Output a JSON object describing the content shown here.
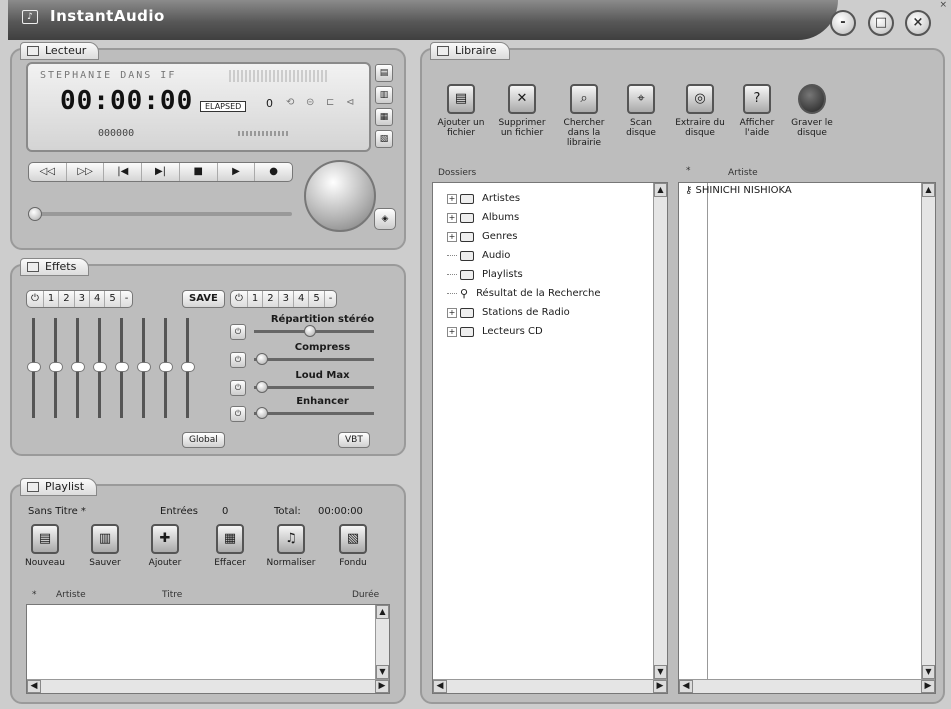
{
  "titlebar": {
    "title": "InstantAudio",
    "icon": "app-icon",
    "minimize": "-",
    "maximize": "□",
    "close": "×",
    "tiny_close": "×"
  },
  "player": {
    "tab": "Lecteur",
    "song_text": "STEPHANIE DANS IF",
    "time": "00:00:00",
    "elapsed_label": "ELAPSED",
    "track_number": "0",
    "sub_counter": "000000",
    "transport": [
      "◁◁",
      "▷▷",
      "|◀",
      "▶|",
      "■",
      "▶",
      "●"
    ]
  },
  "effects": {
    "tab": "Effets",
    "preset_left": [
      "1",
      "2",
      "3",
      "4",
      "5",
      "-"
    ],
    "save_label": "SAVE",
    "preset_right": [
      "1",
      "2",
      "3",
      "4",
      "5",
      "-"
    ],
    "sliders": [
      "Répartition stéréo",
      "Compress",
      "Loud Max",
      "Enhancer"
    ],
    "global_label": "Global",
    "vbt_label": "VBT"
  },
  "playlist": {
    "tab": "Playlist",
    "name": "Sans Titre *",
    "entries_label": "Entrées",
    "entries_value": "0",
    "total_label": "Total:",
    "total_value": "00:00:00",
    "tools": [
      "Nouveau",
      "Sauver",
      "Ajouter",
      "Effacer",
      "Normaliser",
      "Fondu"
    ],
    "columns": {
      "star": "*",
      "artist": "Artiste",
      "title": "Titre",
      "duration": "Durée"
    }
  },
  "library": {
    "tab": "Libraire",
    "tools": [
      {
        "label": "Ajouter un fichier",
        "icon": "add-file-icon"
      },
      {
        "label": "Supprimer un fichier",
        "icon": "delete-icon"
      },
      {
        "label": "Chercher dans la librairie",
        "icon": "search-library-icon"
      },
      {
        "label": "Scan disque",
        "icon": "scan-disk-icon"
      },
      {
        "label": "Extraire du disque",
        "icon": "extract-cd-icon"
      },
      {
        "label": "Afficher l'aide",
        "icon": "help-icon"
      },
      {
        "label": "Graver le disque",
        "icon": "burn-disc-icon"
      }
    ],
    "folders_header": "Dossiers",
    "artist_header": "Artiste",
    "star": "*",
    "tree": [
      "Artistes",
      "Albums",
      "Genres",
      "Audio",
      "Playlists",
      "Résultat de la Recherche",
      "Stations de Radio",
      "Lecteurs CD"
    ],
    "artists": [
      "SHINICHI NISHIOKA"
    ]
  }
}
